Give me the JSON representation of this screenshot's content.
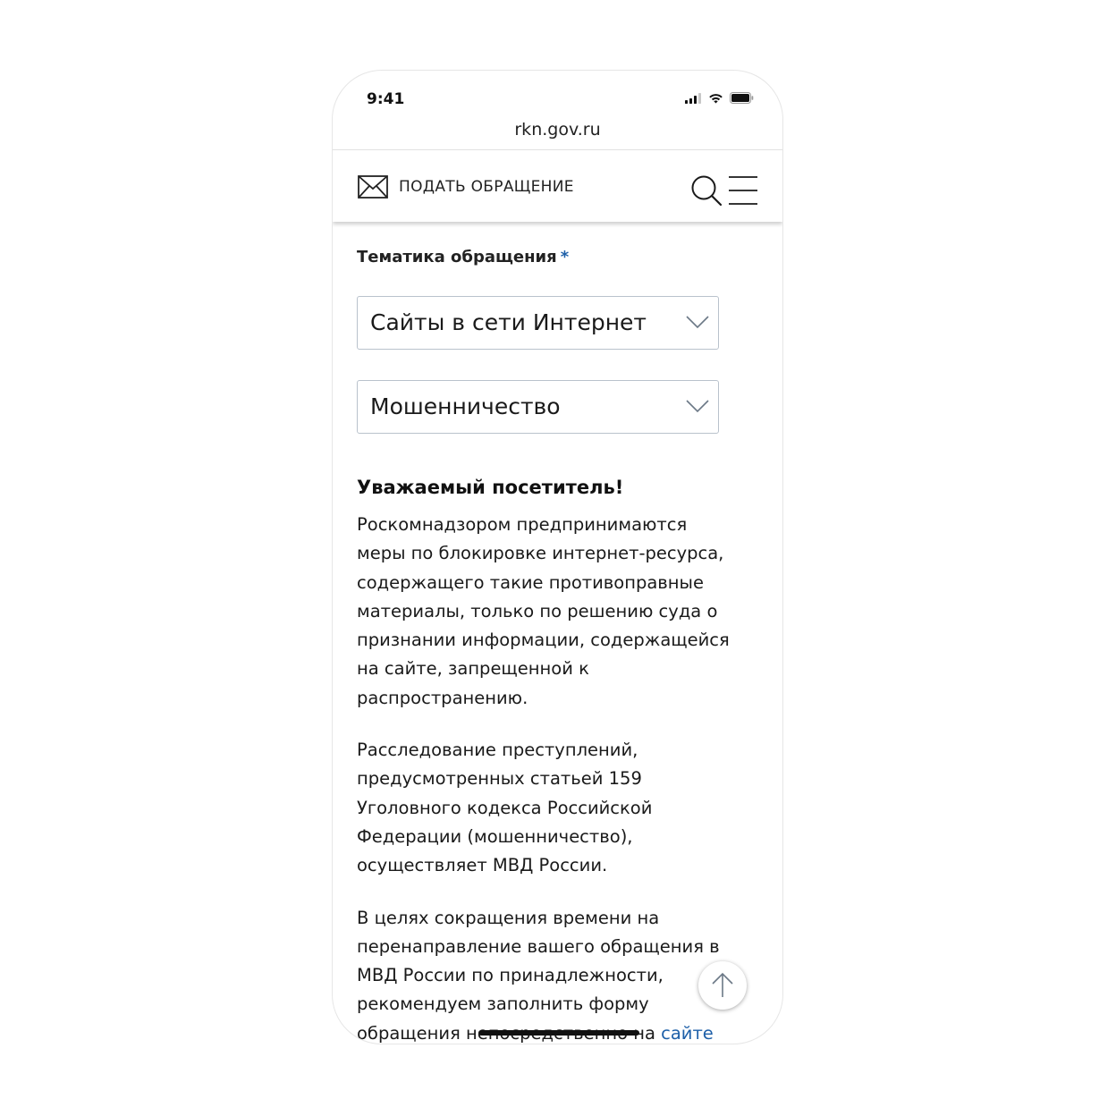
{
  "status_bar": {
    "time": "9:41",
    "icons": [
      "cellular-signal-icon",
      "wifi-icon",
      "battery-icon"
    ]
  },
  "browser": {
    "url": "rkn.gov.ru"
  },
  "header": {
    "appeal_label": "ПОДАТЬ ОБРАЩЕНИЕ",
    "icons": [
      "envelope-icon",
      "search-icon",
      "menu-icon"
    ]
  },
  "form": {
    "topic_label": "Тематика обращения",
    "required_mark": "*",
    "topic_select_value": "Сайты в сети Интернет",
    "subtopic_select_value": "Мошенничество"
  },
  "notice": {
    "title": "Уважаемый посетитель!",
    "paragraph_1": "Роскомнадзором предпринимаются меры по блокировке интернет-ресурса, содержащего такие противоправные материалы, только по решению суда о признании информации, содержащейся на сайте, запрещенной к распространению.",
    "paragraph_2": "Расследование преступлений, предусмотренных статьей 159 Уголовного кодекса Российской Федерации (мошенничество), осуществляет МВД России.",
    "paragraph_3_text": "В целях сокращения времени на перенаправление вашего обращения в МВД России по принадлежности, рекомендуем заполнить форму обращения непосредственно на ",
    "paragraph_3_link": "сайте"
  },
  "colors": {
    "accent": "#1d5fa8",
    "select_border": "#b9c2cc",
    "text": "#1a1a1a"
  }
}
